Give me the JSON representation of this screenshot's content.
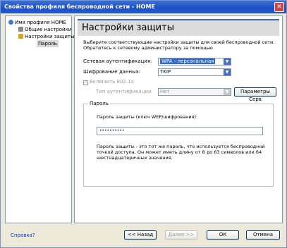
{
  "window": {
    "title": "Свойства профиля беспроводной сети - HOME"
  },
  "tree": {
    "root": "Имя профиля HOME",
    "general": "Общие настройки",
    "security": "Настройки защиты",
    "password": "Пароль"
  },
  "panel": {
    "title": "Настройки защиты",
    "intro": "Выберите соответствующие настройки защиты для своей беспроводной сети. Обратитесь к сетевому администратору за помощью",
    "auth_label": "Сетевая аутентификация:",
    "auth_value": "WPA - персональная",
    "enc_label": "Шифрование данных:",
    "enc_value": "TKIP",
    "enable_8021x": "Включить 802.1x",
    "auth_type_label": "Тип аутентификации:",
    "auth_type_value": "Нет",
    "server_params": "Параметры Серв",
    "password_group": "Пароль",
    "password_field_label": "Пароль защиты (ключ WEP/шифрования):",
    "password_value": "••••••••••",
    "note": "Пароль защиты - это тот же пароль, что используется беспроводной точкой доступа. Он может иметь длину от 8 до 63 символов или 64 шестнадцатеричных значения."
  },
  "footer": {
    "help": "Справка?",
    "back": "<< Назад",
    "next": "Далее >>",
    "ok": "ОК",
    "cancel": "Отмена"
  }
}
